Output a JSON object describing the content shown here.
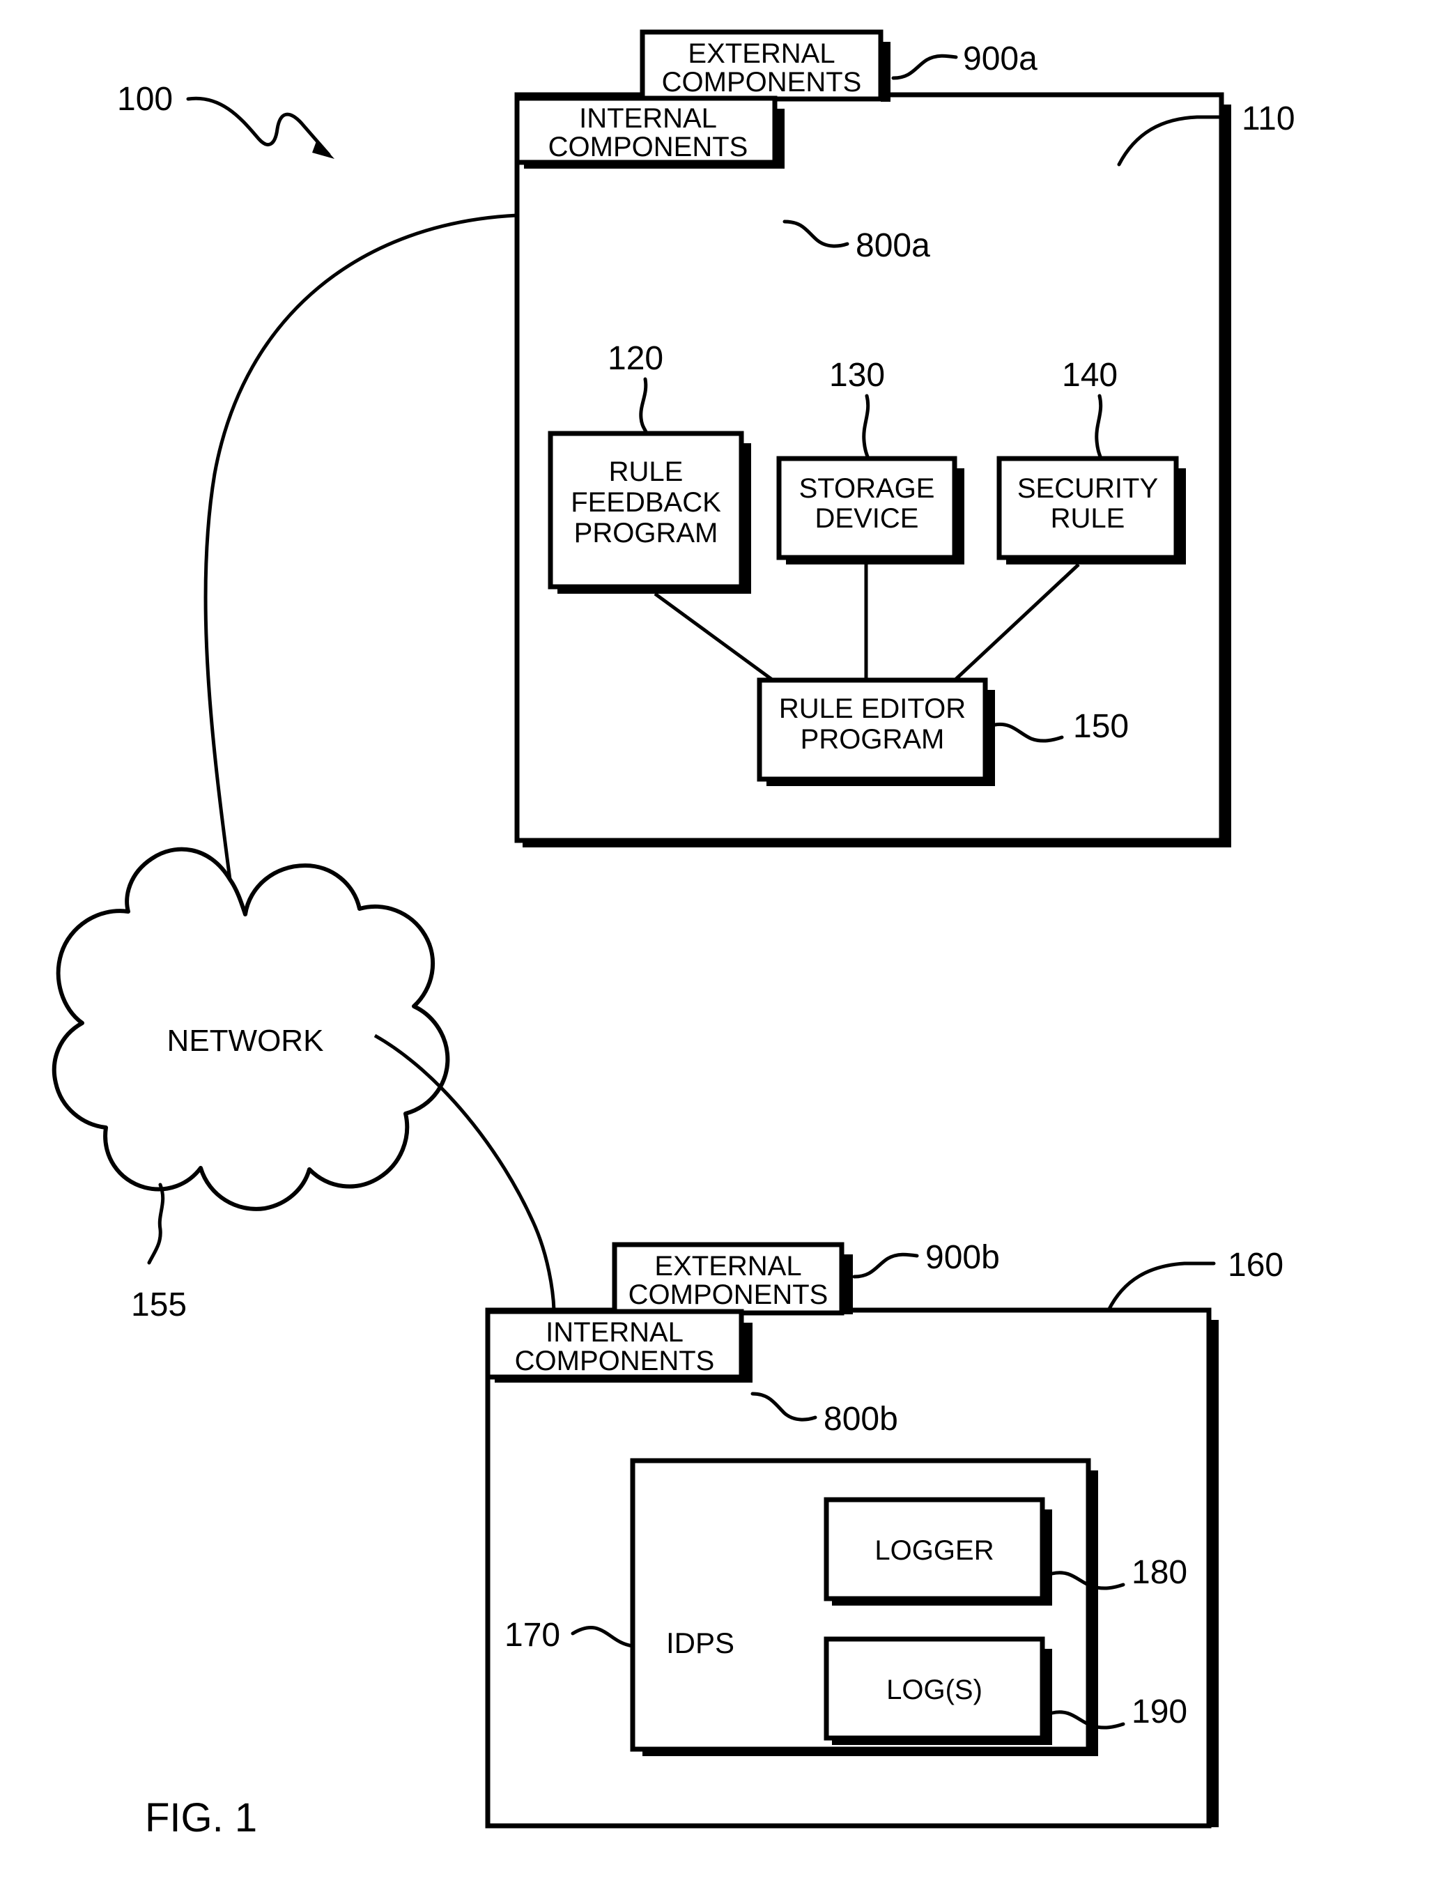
{
  "figure": {
    "caption": "FIG. 1",
    "system_ref": "100"
  },
  "refs": {
    "system": "100",
    "first_computer": "110",
    "rule_feedback_program": "120",
    "storage_device": "130",
    "security_rule": "140",
    "rule_editor_program": "150",
    "network": "155",
    "second_computer": "160",
    "idps": "170",
    "logger": "180",
    "logs": "190",
    "internal_components_a": "800a",
    "external_components_a": "900a",
    "internal_components_b": "800b",
    "external_components_b": "900b"
  },
  "nodes": {
    "external_components_a": {
      "line1": "EXTERNAL",
      "line2": "COMPONENTS"
    },
    "internal_components_a": {
      "line1": "INTERNAL",
      "line2": "COMPONENTS"
    },
    "rule_feedback_program": {
      "line1": "RULE",
      "line2": "FEEDBACK",
      "line3": "PROGRAM"
    },
    "storage_device": {
      "line1": "STORAGE",
      "line2": "DEVICE"
    },
    "security_rule": {
      "line1": "SECURITY",
      "line2": "RULE"
    },
    "rule_editor_program": {
      "line1": "RULE EDITOR",
      "line2": "PROGRAM"
    },
    "network": {
      "label": "NETWORK"
    },
    "external_components_b": {
      "line1": "EXTERNAL",
      "line2": "COMPONENTS"
    },
    "internal_components_b": {
      "line1": "INTERNAL",
      "line2": "COMPONENTS"
    },
    "idps": {
      "label": "IDPS"
    },
    "logger": {
      "label": "LOGGER"
    },
    "logs": {
      "label": "LOG(S)"
    }
  },
  "colors": {
    "stroke": "#000000",
    "fill": "#ffffff",
    "shadow": "#000000"
  }
}
